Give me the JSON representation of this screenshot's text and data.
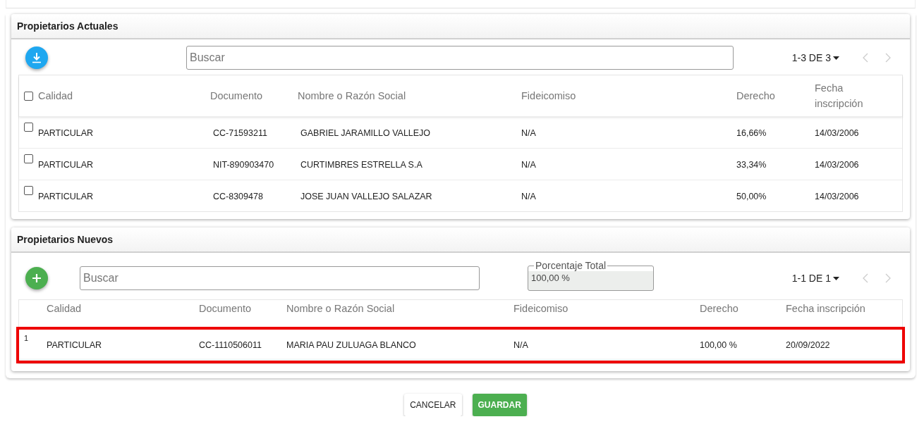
{
  "sections": [
    {
      "title": "Propietarios Actuales",
      "action": {
        "kind": "download"
      },
      "search": {
        "placeholder": "Buscar"
      },
      "pagination": {
        "range": "1-3 DE 3"
      },
      "table": {
        "select_all": {
          "checked": false
        },
        "columns": [
          "Calidad",
          "Documento",
          "Nombre o Razón Social",
          "Fideicomiso",
          "Derecho",
          "Fecha inscripción"
        ],
        "rows": [
          {
            "checked": false,
            "cells": [
              "PARTICULAR",
              "CC-71593211",
              "GABRIEL JARAMILLO VALLEJO",
              "N/A",
              "16,66%",
              "14/03/2006"
            ]
          },
          {
            "checked": false,
            "cells": [
              "PARTICULAR",
              "NIT-890903470",
              "CURTIMBRES ESTRELLA S.A",
              "N/A",
              "33,34%",
              "14/03/2006"
            ]
          },
          {
            "checked": false,
            "cells": [
              "PARTICULAR",
              "CC-8309478",
              "JOSE JUAN VALLEJO SALAZAR",
              "N/A",
              "50,00%",
              "14/03/2006"
            ]
          }
        ]
      }
    },
    {
      "title": "Propietarios Nuevos",
      "action": {
        "kind": "add"
      },
      "search": {
        "placeholder": "Buscar"
      },
      "total": {
        "label": "Porcentaje Total",
        "value": "100,00 %"
      },
      "pagination": {
        "range": "1-1 DE 1"
      },
      "table": {
        "columns": [
          "Calidad",
          "Documento",
          "Nombre o Razón Social",
          "Fideicomiso",
          "Derecho",
          "Fecha inscripción"
        ],
        "rows": [
          {
            "number": "1",
            "highlighted": true,
            "cells": [
              "PARTICULAR",
              "CC-1110506011",
              "MARIA PAU ZULUAGA BLANCO",
              "N/A",
              "100,00 %",
              "20/09/2022"
            ]
          }
        ]
      }
    }
  ],
  "buttons": [
    {
      "label": "CANCELAR",
      "kind": "secondary"
    },
    {
      "label": "GUARDAR",
      "kind": "primary"
    }
  ]
}
